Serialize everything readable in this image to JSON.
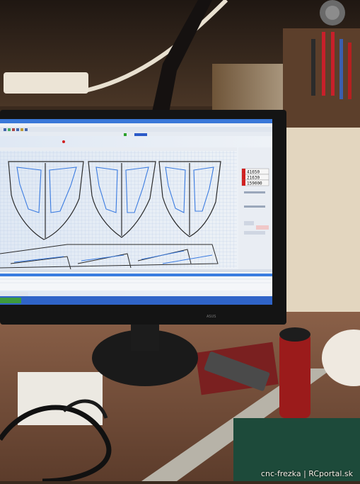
{
  "watermark": "cnc-frezka | RCportal.sk",
  "monitor": {
    "brand": "ASUS"
  },
  "dro_readouts": [
    "41650",
    "21630",
    "159000"
  ],
  "colors": {
    "wall": "#e6d9c3",
    "screen_grid": "#c9d7ea",
    "taskbar": "#2f64c8",
    "parts_outline": "#2b2b2b",
    "toolpath": "#3a7be0"
  }
}
